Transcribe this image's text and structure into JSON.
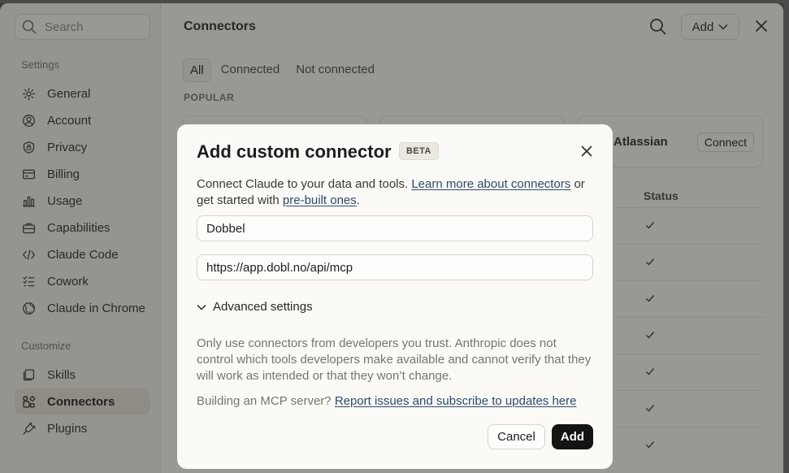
{
  "sidebar": {
    "search_placeholder": "Search",
    "settings_label": "Settings",
    "customize_label": "Customize",
    "settings_items": [
      {
        "label": "General",
        "icon": "gear-icon"
      },
      {
        "label": "Account",
        "icon": "user-circle-icon"
      },
      {
        "label": "Privacy",
        "icon": "shield-lock-icon"
      },
      {
        "label": "Billing",
        "icon": "credit-card-icon"
      },
      {
        "label": "Usage",
        "icon": "bar-chart-icon"
      },
      {
        "label": "Capabilities",
        "icon": "briefcase-icon"
      },
      {
        "label": "Claude Code",
        "icon": "code-icon"
      },
      {
        "label": "Cowork",
        "icon": "checklist-icon"
      },
      {
        "label": "Claude in Chrome",
        "icon": "globe-icon"
      }
    ],
    "customize_items": [
      {
        "label": "Skills",
        "icon": "skills-icon"
      },
      {
        "label": "Connectors",
        "icon": "connectors-icon",
        "active": true
      },
      {
        "label": "Plugins",
        "icon": "plug-icon"
      }
    ]
  },
  "main": {
    "title": "Connectors",
    "add_label": "Add",
    "tabs": [
      {
        "label": "All",
        "active": true
      },
      {
        "label": "Connected"
      },
      {
        "label": "Not connected"
      }
    ],
    "popular_label": "POPULAR",
    "visible_card": {
      "name": "Atlassian",
      "button": "Connect"
    },
    "status_header": "Status",
    "status_rows": 7
  },
  "modal": {
    "title": "Add custom connector",
    "badge": "BETA",
    "desc_prefix": "Connect Claude to your data and tools. ",
    "desc_link1": "Learn more about connectors",
    "desc_mid": " or get started with ",
    "desc_link2": "pre-built ones",
    "desc_suffix": ".",
    "name_value": "Dobbel",
    "url_value": "https://app.dobl.no/api/mcp",
    "advanced_label": "Advanced settings",
    "warning": "Only use connectors from developers you trust. Anthropic does not control which tools developers make available and cannot verify that they will work as intended or that they won’t change.",
    "mcp_prefix": "Building an MCP server? ",
    "mcp_link": "Report issues and subscribe to updates here",
    "cancel_label": "Cancel",
    "add_label": "Add"
  },
  "colors": {
    "primary_button": "#141413",
    "link": "#2c4a6e",
    "active_nav": "#e3e0d7"
  }
}
